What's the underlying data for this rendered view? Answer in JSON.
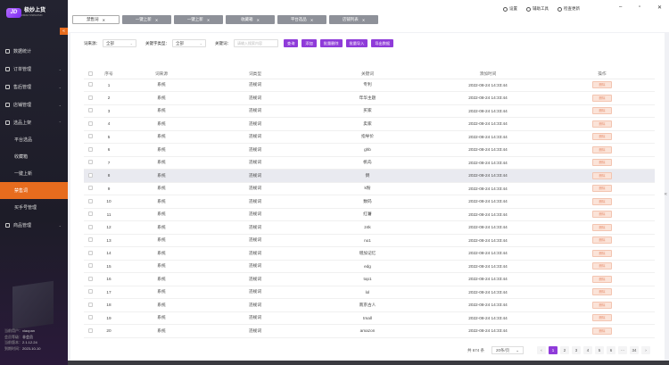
{
  "app": {
    "logo_text": "极妙上货",
    "logo_sub": "JIMIAO SHANGHUO",
    "logo_mark": "JD"
  },
  "sidebar": {
    "items": [
      {
        "label": "数据统计",
        "arrow": ""
      },
      {
        "label": "订单管理",
        "arrow": "⌄"
      },
      {
        "label": "售后管理",
        "arrow": "⌄"
      },
      {
        "label": "店铺管理",
        "arrow": "⌄"
      },
      {
        "label": "选品上架",
        "arrow": "⌃"
      }
    ],
    "sub_items": [
      {
        "label": "平台选品"
      },
      {
        "label": "收藏箱"
      },
      {
        "label": "一键上新"
      },
      {
        "label": "禁售词"
      },
      {
        "label": "买手号管理"
      }
    ],
    "bottom_item": {
      "label": "商品管理",
      "arrow": "⌄"
    }
  },
  "user_info": {
    "user_label": "当前用户：",
    "user_value": "xiaopan",
    "level_label": "会员等级：",
    "level_value": "非会员",
    "version_label": "当前版本：",
    "version_value": "2.1.12.24",
    "expire_label": "到期时间：",
    "expire_value": "2023-10-10"
  },
  "tabs": [
    {
      "label": "禁售词",
      "active": true
    },
    {
      "label": "一键上新",
      "active": false
    },
    {
      "label": "一键上新",
      "active": false
    },
    {
      "label": "收藏箱",
      "active": false
    },
    {
      "label": "平台选品",
      "active": false
    },
    {
      "label": "店铺列表",
      "active": false
    }
  ],
  "toolbar": {
    "settings": "设置",
    "tools": "辅助工具",
    "update": "检查更新",
    "minimize": "–",
    "maximize": "▫",
    "close": "✕"
  },
  "filters": {
    "source_label": "词来源：",
    "source_value": "全部",
    "type_label": "关键字类型：",
    "type_value": "全部",
    "keyword_label": "关键词：",
    "keyword_placeholder": "请输入搜索内容",
    "buttons": [
      "查询",
      "添加",
      "批量删除",
      "批量导入",
      "导出数据"
    ]
  },
  "table": {
    "headers": [
      "序号",
      "词来源",
      "词类型",
      "关键词",
      "添加时间",
      "操作"
    ],
    "delete_label": "删除",
    "rows": [
      [
        "1",
        "系统",
        "违规词",
        "专利",
        "2022-08-24 14:33:44"
      ],
      [
        "2",
        "系统",
        "违规词",
        "年华主题",
        "2022-08-24 14:33:44"
      ],
      [
        "3",
        "系统",
        "违规词",
        "买家",
        "2022-08-24 14:33:44"
      ],
      [
        "4",
        "系统",
        "违规词",
        "卖家",
        "2022-08-24 14:33:44"
      ],
      [
        "5",
        "系统",
        "违规词",
        "指导价",
        "2022-08-24 14:33:44"
      ],
      [
        "6",
        "系统",
        "违规词",
        "ghb",
        "2022-08-24 14:33:44"
      ],
      [
        "7",
        "系统",
        "违规词",
        "帆岛",
        "2022-08-24 14:33:44"
      ],
      [
        "8",
        "系统",
        "违规词",
        "倒",
        "2022-08-24 14:33:44"
      ],
      [
        "9",
        "系统",
        "违规词",
        "k粉",
        "2022-08-24 14:33:44"
      ],
      [
        "10",
        "系统",
        "违规词",
        "数码",
        "2022-08-24 14:33:44"
      ],
      [
        "11",
        "系统",
        "违规词",
        "红薯",
        "2022-08-24 14:33:44"
      ],
      [
        "12",
        "系统",
        "违规词",
        "24k",
        "2022-08-24 14:33:44"
      ],
      [
        "13",
        "系统",
        "违规词",
        "no1",
        "2022-08-24 14:33:44"
      ],
      [
        "14",
        "系统",
        "违规词",
        "增加记忆",
        "2022-08-24 14:33:44"
      ],
      [
        "15",
        "系统",
        "违规词",
        "edg",
        "2022-08-24 14:33:44"
      ],
      [
        "16",
        "系统",
        "违规词",
        "top1",
        "2022-08-24 14:33:44"
      ],
      [
        "17",
        "系统",
        "违规词",
        "lol",
        "2022-08-24 14:33:44"
      ],
      [
        "18",
        "系统",
        "违规词",
        "南京古人",
        "2022-08-24 14:33:44"
      ],
      [
        "19",
        "系统",
        "违规词",
        "tmall",
        "2022-08-24 14:33:44"
      ],
      [
        "20",
        "系统",
        "违规词",
        "amazon",
        "2022-08-24 14:33:44"
      ]
    ],
    "highlighted_row": 8
  },
  "pager": {
    "total": "共 674 条",
    "page_size": "20条/页",
    "prev": "‹",
    "next": "›",
    "pages": [
      "1",
      "2",
      "3",
      "4",
      "5",
      "6",
      "···",
      "34"
    ],
    "current": "1"
  },
  "colors": {
    "accent": "#8f3bd9",
    "sidebar_active": "#e76c1e",
    "delete_bg": "#fbe3d8"
  }
}
